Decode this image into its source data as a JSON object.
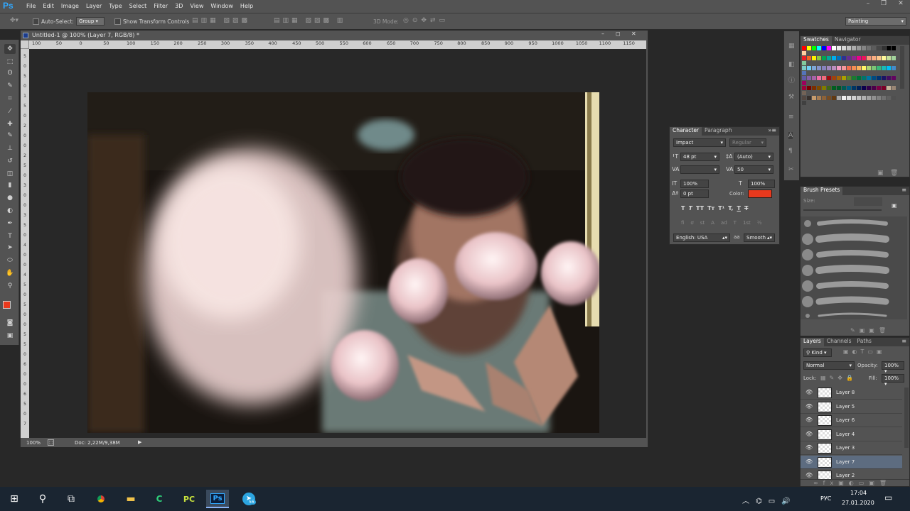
{
  "app": {
    "logo": "Ps",
    "title": "Untitled-1 @ 100% (Layer 7, RGB/8) *",
    "workspace": "Painting"
  },
  "menu": [
    "File",
    "Edit",
    "Image",
    "Layer",
    "Type",
    "Select",
    "Filter",
    "3D",
    "View",
    "Window",
    "Help"
  ],
  "options": {
    "auto_select_label": "Auto-Select:",
    "auto_select_value": "Group",
    "transform_label": "Show Transform Controls",
    "mode3d_label": "3D Mode:"
  },
  "ruler_h": [
    "100",
    "50",
    "0",
    "50",
    "100",
    "150",
    "200",
    "250",
    "300",
    "350",
    "400",
    "450",
    "500",
    "550",
    "600",
    "650",
    "700",
    "750",
    "800",
    "850",
    "900",
    "950",
    "1000",
    "1050",
    "1100",
    "1150"
  ],
  "ruler_v": [
    "5",
    "0",
    "5",
    "0",
    "1",
    "5",
    "0",
    "2",
    "0",
    "0",
    "2",
    "5",
    "0",
    "3",
    "0",
    "0",
    "3",
    "5",
    "0",
    "4",
    "0",
    "0",
    "4",
    "5",
    "0",
    "5",
    "0",
    "0",
    "5",
    "5",
    "0",
    "6",
    "0",
    "0",
    "6",
    "5",
    "0",
    "7"
  ],
  "status": {
    "zoom": "100%",
    "doc": "Doc: 2,22M/9,38M"
  },
  "swatches_panel": {
    "tabs": [
      "Swatches",
      "Navigator"
    ]
  },
  "character": {
    "tabs": [
      "Character",
      "Paragraph"
    ],
    "font": "Impact",
    "style": "Regular",
    "size": "48 pt",
    "leading": "(Auto)",
    "kerning": "",
    "tracking": "50",
    "vscale": "100%",
    "hscale": "100%",
    "baseline": "0 pt",
    "color_label": "Color:",
    "color": "#e8391d",
    "language": "English: USA",
    "aa_label": "aа",
    "aa": "Smooth",
    "type_buttons": [
      "T",
      "T",
      "TT",
      "Tт",
      "T¹",
      "T,",
      "T",
      "T"
    ]
  },
  "brush": {
    "title": "Brush Presets",
    "size_label": "Size:"
  },
  "layers": {
    "tabs": [
      "Layers",
      "Channels",
      "Paths"
    ],
    "kind": "Kind",
    "blend": "Normal",
    "opacity_label": "Opacity:",
    "opacity": "100%",
    "lock_label": "Lock:",
    "fill_label": "Fill:",
    "fill": "100%",
    "items": [
      {
        "name": "Layer 8"
      },
      {
        "name": "Layer 5"
      },
      {
        "name": "Layer 6"
      },
      {
        "name": "Layer 4"
      },
      {
        "name": "Layer 3"
      },
      {
        "name": "Layer 7",
        "selected": true
      },
      {
        "name": "Layer 2"
      }
    ]
  },
  "taskbar": {
    "time": "17:04",
    "date": "27.01.2020",
    "lang": "РУС",
    "badge": "56"
  }
}
